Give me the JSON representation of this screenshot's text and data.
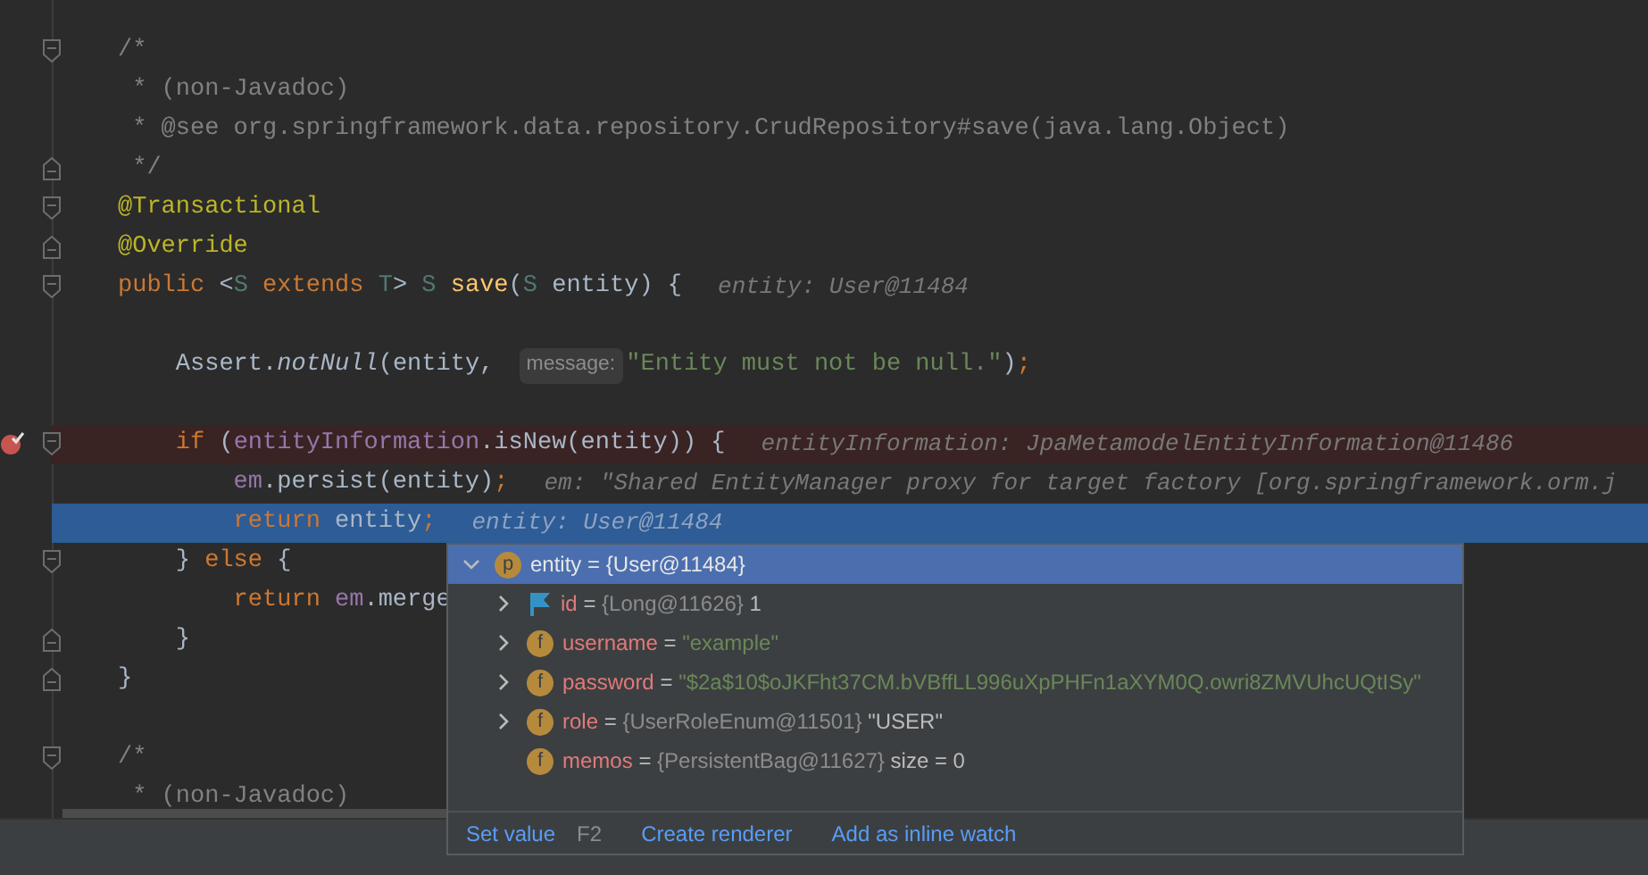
{
  "editor": {
    "lines": [
      {
        "breakpoint": false,
        "current": false,
        "fold_start": true,
        "fold_end": false,
        "segments": [
          {
            "kind": "code",
            "tokens": [
              {
                "t": "/*",
                "kind": "comment"
              }
            ]
          }
        ]
      },
      {
        "breakpoint": false,
        "current": false,
        "fold_start": false,
        "fold_end": false,
        "segments": [
          {
            "kind": "code",
            "tokens": [
              {
                "t": " * (non-Javadoc)",
                "kind": "comment"
              }
            ]
          }
        ]
      },
      {
        "breakpoint": false,
        "current": false,
        "fold_start": false,
        "fold_end": false,
        "segments": [
          {
            "kind": "code",
            "tokens": [
              {
                "t": " * @see org.springframework.data.repository.CrudRepository#save(java.lang.Object)",
                "kind": "comment"
              }
            ]
          }
        ]
      },
      {
        "breakpoint": false,
        "current": false,
        "fold_start": false,
        "fold_end": true,
        "segments": [
          {
            "kind": "code",
            "tokens": [
              {
                "t": " */",
                "kind": "comment"
              }
            ]
          }
        ]
      },
      {
        "breakpoint": false,
        "current": false,
        "fold_start": true,
        "fold_end": false,
        "segments": [
          {
            "kind": "code",
            "tokens": [
              {
                "t": "@Transactional",
                "kind": "annotation"
              }
            ]
          }
        ]
      },
      {
        "breakpoint": false,
        "current": false,
        "fold_start": false,
        "fold_end": true,
        "segments": [
          {
            "kind": "code",
            "tokens": [
              {
                "t": "@Override",
                "kind": "annotation"
              }
            ]
          }
        ]
      },
      {
        "breakpoint": false,
        "current": false,
        "fold_start": true,
        "fold_end": false,
        "segments": [
          {
            "kind": "code",
            "tokens": [
              {
                "t": "public ",
                "kind": "keyword"
              },
              {
                "t": "<",
                "kind": "plain"
              },
              {
                "t": "S",
                "kind": "type-param"
              },
              {
                "t": " extends ",
                "kind": "keyword"
              },
              {
                "t": "T",
                "kind": "type-param"
              },
              {
                "t": "> ",
                "kind": "plain"
              },
              {
                "t": "S ",
                "kind": "type-param"
              },
              {
                "t": "save",
                "kind": "method"
              },
              {
                "t": "(",
                "kind": "plain"
              },
              {
                "t": "S",
                "kind": "type-param"
              },
              {
                "t": " entity) {",
                "kind": "plain"
              }
            ]
          },
          {
            "kind": "value-hint",
            "text": "entity: User@11484"
          }
        ]
      },
      {
        "breakpoint": false,
        "current": false,
        "fold_start": false,
        "fold_end": false
      },
      {
        "breakpoint": false,
        "current": false,
        "fold_start": false,
        "fold_end": false,
        "segments": [
          {
            "kind": "code",
            "tokens": [
              {
                "t": "    Assert.",
                "kind": "plain"
              },
              {
                "t": "notNull",
                "kind": "static"
              },
              {
                "t": "(entity, ",
                "kind": "plain"
              }
            ]
          },
          {
            "kind": "param-hint",
            "text": "message:"
          },
          {
            "kind": "code",
            "tokens": [
              {
                "t": "\"Entity must not be null.\"",
                "kind": "string"
              },
              {
                "t": ")",
                "kind": "plain"
              },
              {
                "t": ";",
                "kind": "keyword"
              }
            ]
          }
        ]
      },
      {
        "breakpoint": false,
        "current": false,
        "fold_start": false,
        "fold_end": false
      },
      {
        "breakpoint": true,
        "current": false,
        "fold_start": true,
        "fold_end": false,
        "segments": [
          {
            "kind": "code",
            "tokens": [
              {
                "t": "    if ",
                "kind": "keyword"
              },
              {
                "t": "(",
                "kind": "plain"
              },
              {
                "t": "entityInformation",
                "kind": "field"
              },
              {
                "t": ".isNew(entity)) {",
                "kind": "plain"
              }
            ]
          },
          {
            "kind": "value-hint",
            "text": "entityInformation: JpaMetamodelEntityInformation@11486"
          }
        ]
      },
      {
        "breakpoint": false,
        "current": false,
        "fold_start": false,
        "fold_end": false,
        "segments": [
          {
            "kind": "code",
            "tokens": [
              {
                "t": "        em",
                "kind": "field"
              },
              {
                "t": ".persist(entity)",
                "kind": "plain"
              },
              {
                "t": ";",
                "kind": "keyword"
              }
            ]
          },
          {
            "kind": "value-hint",
            "text": "em: \"Shared EntityManager proxy for target factory [org.springframework.orm.j"
          }
        ]
      },
      {
        "breakpoint": false,
        "current": true,
        "fold_start": false,
        "fold_end": false,
        "segments": [
          {
            "kind": "code",
            "tokens": [
              {
                "t": "        return ",
                "kind": "keyword"
              },
              {
                "t": "entity",
                "kind": "plain"
              },
              {
                "t": ";",
                "kind": "keyword"
              }
            ]
          },
          {
            "kind": "value-hint",
            "text": "entity: User@11484"
          }
        ]
      },
      {
        "breakpoint": false,
        "current": false,
        "fold_start": true,
        "fold_end": false,
        "segments": [
          {
            "kind": "code",
            "tokens": [
              {
                "t": "    } ",
                "kind": "plain"
              },
              {
                "t": "else ",
                "kind": "keyword"
              },
              {
                "t": "{",
                "kind": "plain"
              }
            ]
          }
        ]
      },
      {
        "breakpoint": false,
        "current": false,
        "fold_start": false,
        "fold_end": false,
        "segments": [
          {
            "kind": "code",
            "tokens": [
              {
                "t": "        return ",
                "kind": "keyword"
              },
              {
                "t": "em",
                "kind": "field"
              },
              {
                "t": ".merge",
                "kind": "plain"
              }
            ]
          }
        ]
      },
      {
        "breakpoint": false,
        "current": false,
        "fold_start": false,
        "fold_end": true,
        "segments": [
          {
            "kind": "code",
            "tokens": [
              {
                "t": "    }",
                "kind": "plain"
              }
            ]
          }
        ]
      },
      {
        "breakpoint": false,
        "current": false,
        "fold_start": false,
        "fold_end": true,
        "segments": [
          {
            "kind": "code",
            "tokens": [
              {
                "t": "}",
                "kind": "plain"
              }
            ]
          }
        ]
      },
      {
        "breakpoint": false,
        "current": false,
        "fold_start": false,
        "fold_end": false
      },
      {
        "breakpoint": false,
        "current": false,
        "fold_start": true,
        "fold_end": false,
        "segments": [
          {
            "kind": "code",
            "tokens": [
              {
                "t": "/*",
                "kind": "comment"
              }
            ]
          }
        ]
      },
      {
        "breakpoint": false,
        "current": false,
        "fold_start": false,
        "fold_end": false,
        "segments": [
          {
            "kind": "code",
            "tokens": [
              {
                "t": " * (non-Javadoc)",
                "kind": "comment"
              }
            ]
          }
        ]
      }
    ]
  },
  "debug_popup": {
    "tree": [
      {
        "name": "entity",
        "equals": "=",
        "type": "{User@11484}",
        "badge": "p",
        "kind": "badge",
        "expanded": true,
        "selected": true,
        "children": [
          {
            "name": "id",
            "equals": "=",
            "type": "{Long@11626}",
            "value": "1",
            "kind": "flag",
            "expanded": false,
            "selected": false
          },
          {
            "name": "username",
            "equals": "=",
            "string_value": "\"example\"",
            "badge": "f",
            "kind": "badge",
            "expanded": false,
            "selected": false
          },
          {
            "name": "password",
            "equals": "=",
            "string_value": "\"$2a$10$oJKFht37CM.bVBffLL996uXpPHFn1aXYM0Q.owri8ZMVUhcUQtISy\"",
            "badge": "f",
            "kind": "badge",
            "expanded": false,
            "selected": false
          },
          {
            "name": "role",
            "equals": "=",
            "type": "{UserRoleEnum@11501}",
            "value": "\"USER\"",
            "badge": "f",
            "kind": "badge",
            "expanded": false,
            "selected": false
          },
          {
            "name": "memos",
            "equals": "=",
            "type": "{PersistentBag@11627}",
            "value": "size = 0",
            "badge": "f",
            "kind": "badge",
            "selected": false
          }
        ]
      }
    ],
    "actions": [
      {
        "label": "Set value",
        "shortcut": "F2"
      },
      {
        "label": "Create renderer"
      },
      {
        "label": "Add as inline watch"
      }
    ]
  }
}
